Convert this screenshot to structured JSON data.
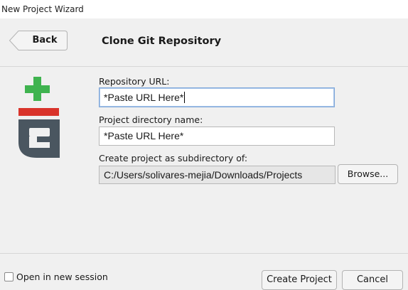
{
  "window": {
    "title": "New Project Wizard"
  },
  "header": {
    "back_label": "Back",
    "title": "Clone Git Repository"
  },
  "form": {
    "repo_url": {
      "label": "Repository URL:",
      "value": "*Paste URL Here*"
    },
    "project_dir": {
      "label": "Project directory name:",
      "value": "*Paste URL Here*"
    },
    "subdirectory": {
      "label": "Create project as subdirectory of:",
      "value": "C:/Users/solivares-mejia/Downloads/Projects",
      "browse_label": "Browse..."
    }
  },
  "footer": {
    "open_new_session_label": "Open in new session",
    "open_new_session_checked": false,
    "create_label": "Create Project",
    "cancel_label": "Cancel"
  },
  "logo": {
    "name": "git-icon",
    "colors": {
      "plus": "#3fb34f",
      "bar": "#d9342b",
      "g": "#4a5660"
    }
  }
}
